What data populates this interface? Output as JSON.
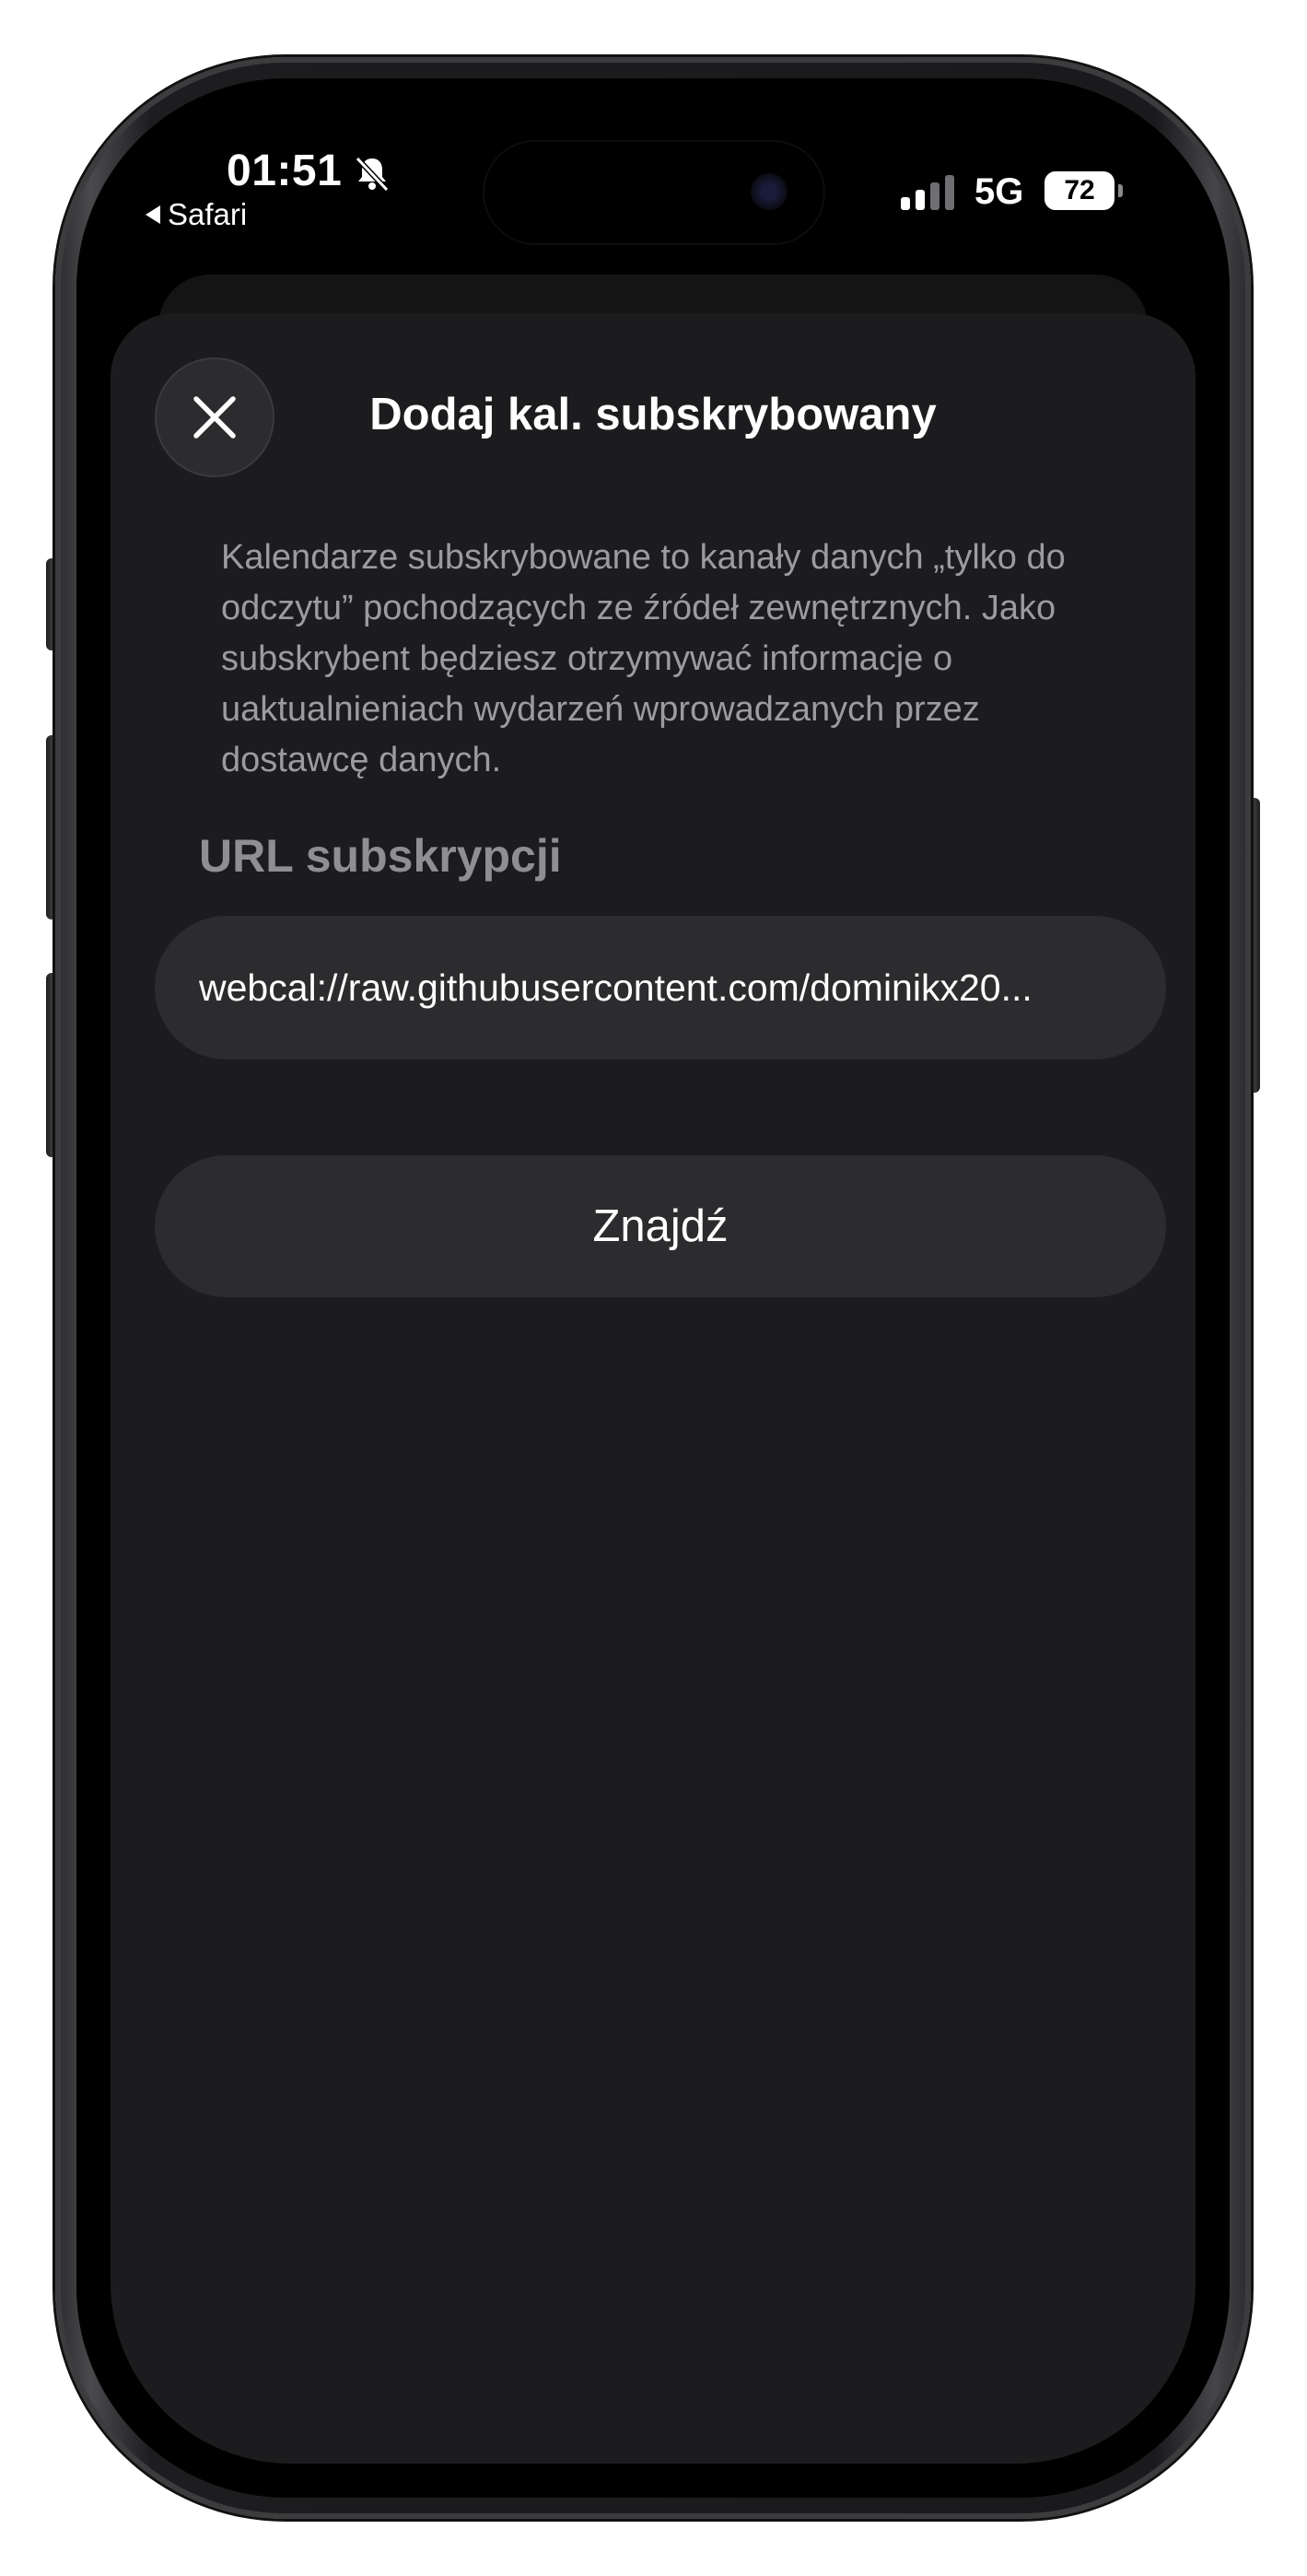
{
  "status_bar": {
    "time": "01:51",
    "back_app": "Safari",
    "network": "5G",
    "battery": "72",
    "icons": [
      "bell-slash-icon",
      "signal-icon",
      "battery-icon"
    ]
  },
  "sheet": {
    "title": "Dodaj kal. subskrybowany",
    "close_icon": "close-icon",
    "description": "Kalendarze subskrybowane to kanały danych „tylko do odczytu” pochodzących ze źródeł zewnętrznych. Jako subskrybent będziesz otrzymywać informacje o uaktualnieniach wydarzeń wprowadzanych przez dostawcę danych.",
    "url_section_label": "URL subskrypcji",
    "url_value": "webcal://raw.githubusercontent.com/dominikx20...",
    "find_button_label": "Znajdź"
  },
  "colors": {
    "sheet_background": "#1c1c1e",
    "control_background": "#2c2c2e",
    "text_primary": "#ffffff",
    "text_secondary": "#9b9ba0"
  }
}
